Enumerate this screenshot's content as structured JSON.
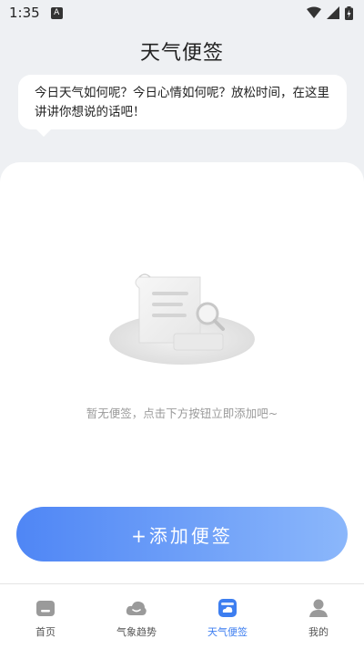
{
  "status_bar": {
    "time": "1:35",
    "notification_glyph": "A"
  },
  "header": {
    "title": "天气便签"
  },
  "bubble": {
    "text": "今日天气如何呢？今日心情如何呢？放松时间，在这里讲讲你想说的话吧！"
  },
  "empty_state": {
    "message": "暂无便签，点击下方按钮立即添加吧~"
  },
  "add_button": {
    "label": "+添加便签"
  },
  "tabs": [
    {
      "label": "首页",
      "icon": "home-icon",
      "active": false
    },
    {
      "label": "气象趋势",
      "icon": "cloud-icon",
      "active": false
    },
    {
      "label": "天气便签",
      "icon": "note-icon",
      "active": true
    },
    {
      "label": "我的",
      "icon": "person-icon",
      "active": false
    }
  ],
  "colors": {
    "accent": "#3d7ef0",
    "button_start": "#4f86f5",
    "button_end": "#8bb7fb",
    "inactive_icon": "#9a9a9a"
  }
}
